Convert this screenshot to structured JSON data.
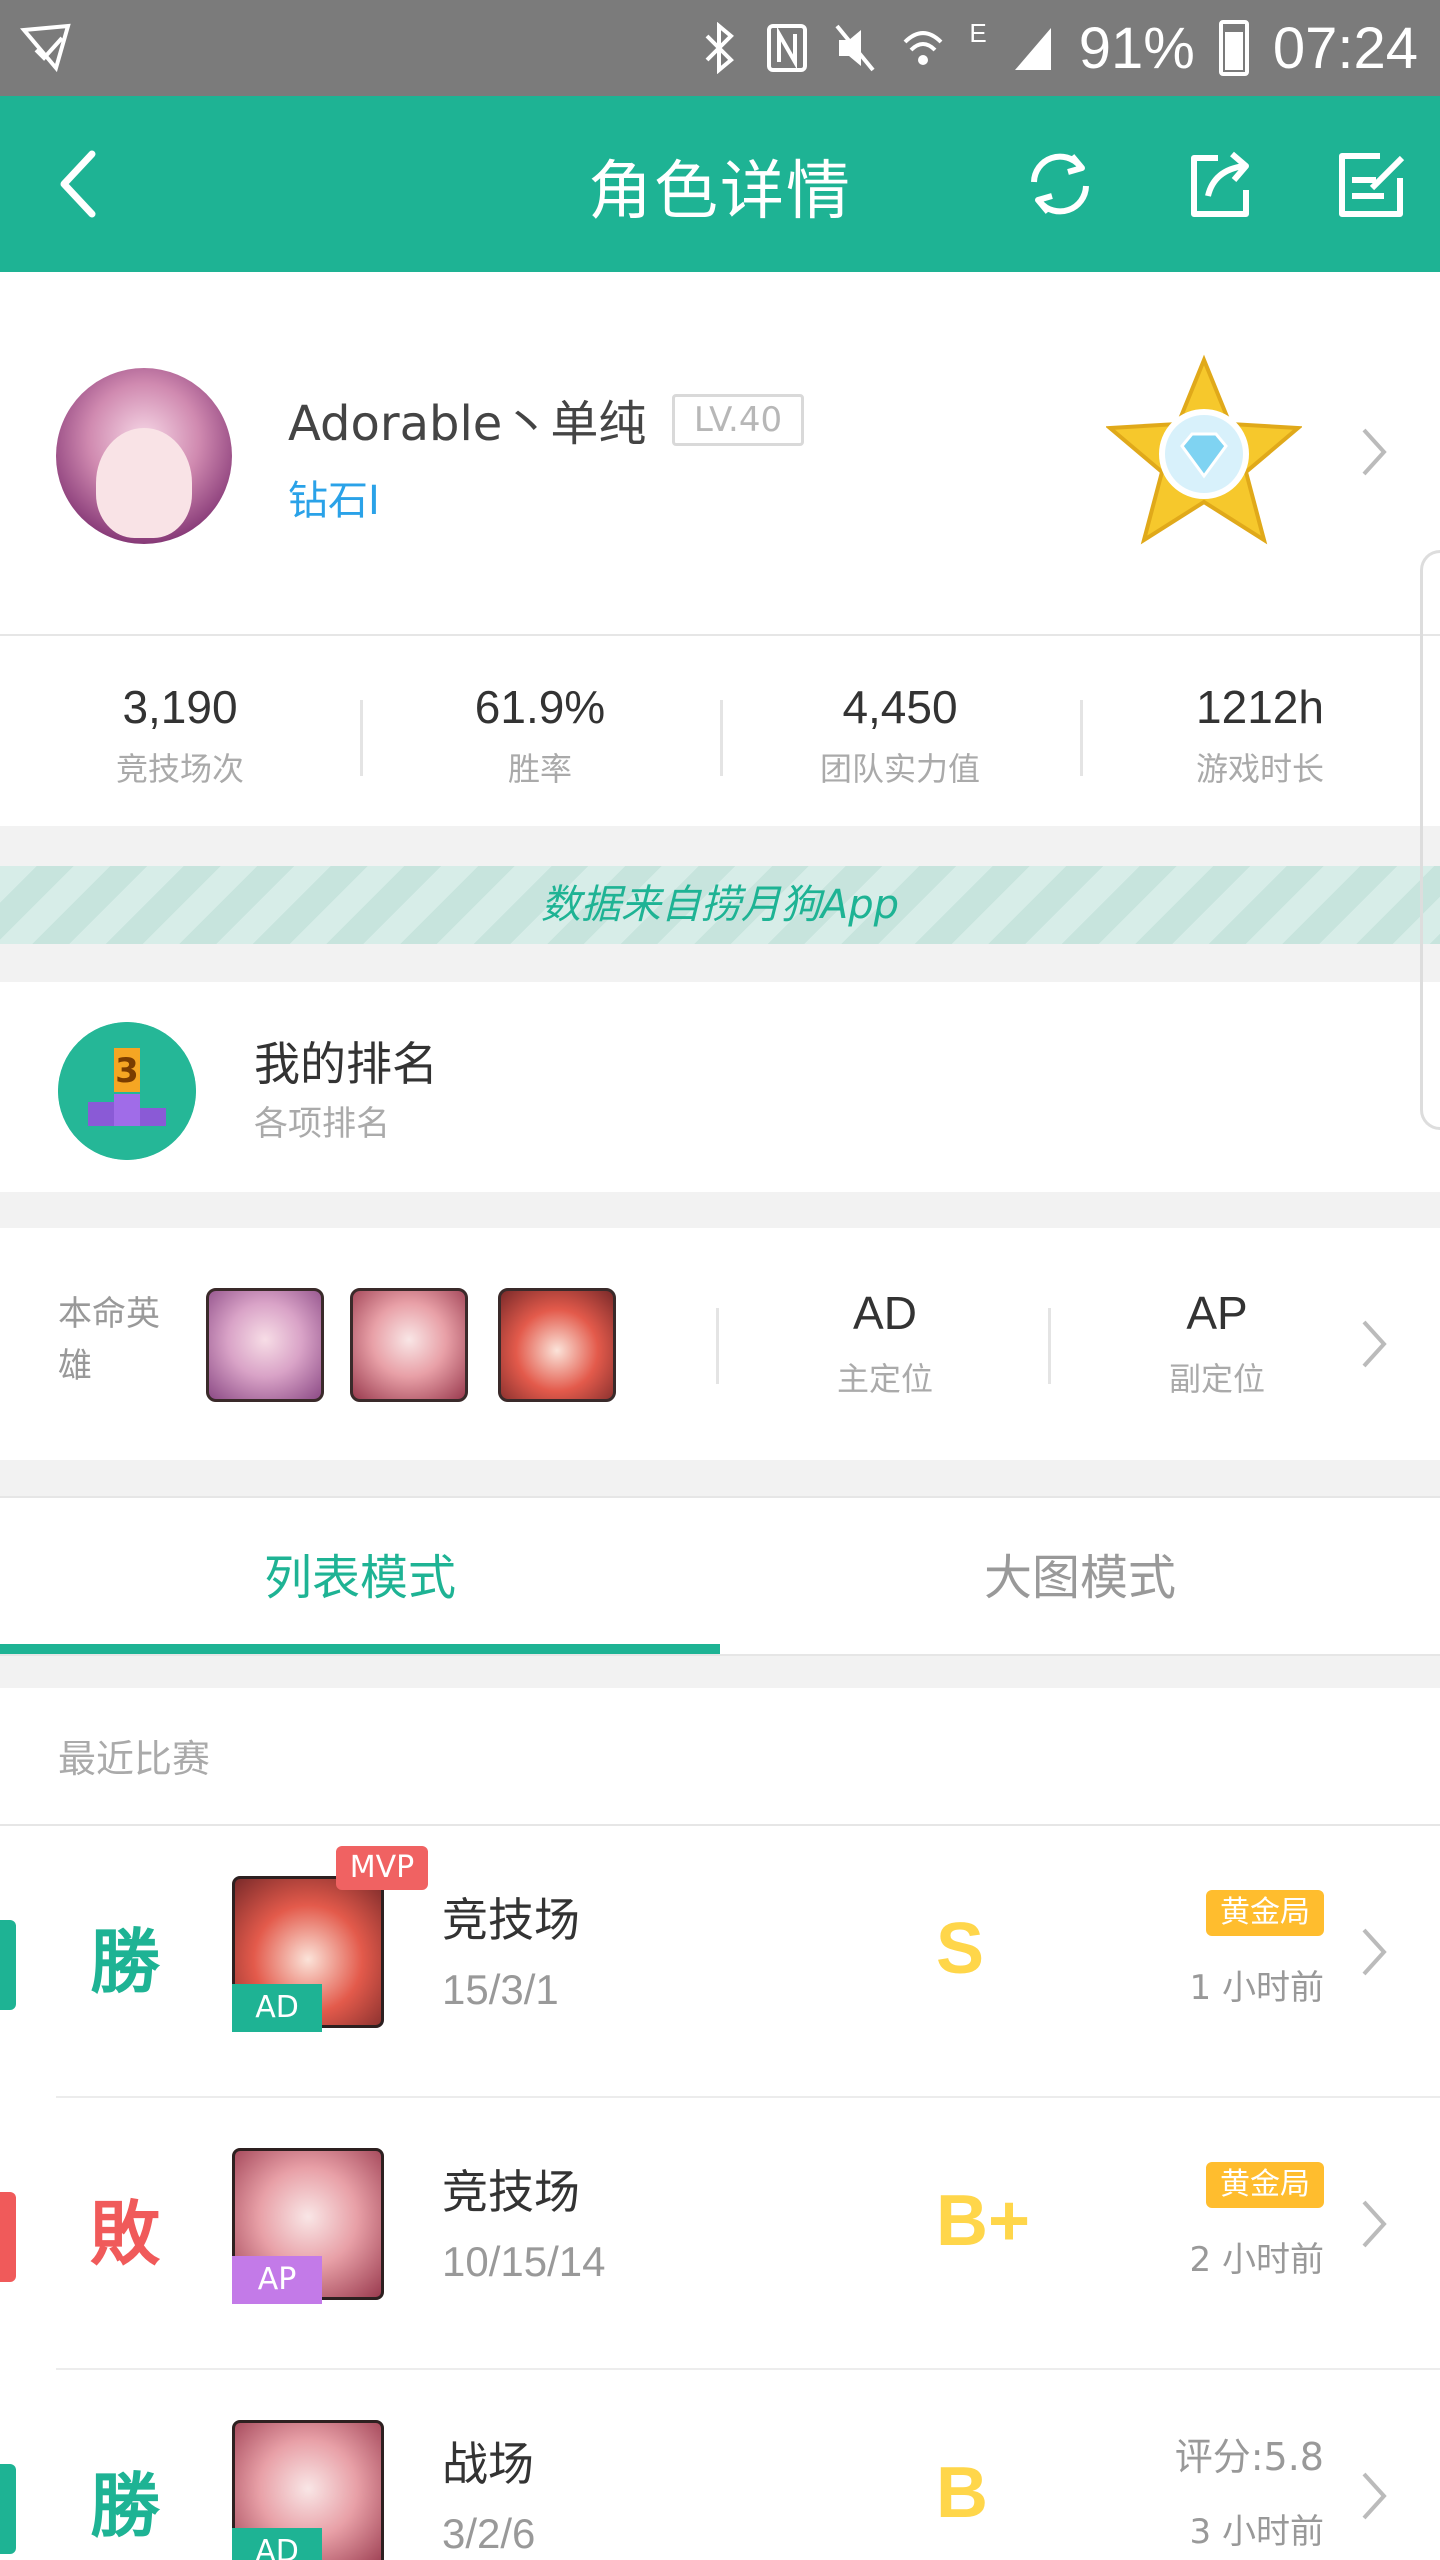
{
  "status_bar": {
    "battery": "91%",
    "time": "07:24",
    "network": "E"
  },
  "header": {
    "title": "角色详情",
    "icons": [
      "back-icon",
      "refresh-icon",
      "share-icon",
      "edit-icon"
    ]
  },
  "profile": {
    "name": "Adorable丶单纯",
    "level": "LV.40",
    "rank": "钻石I",
    "rank_icon": "diamond-star-icon"
  },
  "stats": [
    {
      "value": "3,190",
      "label": "竞技场次"
    },
    {
      "value": "61.9%",
      "label": "胜率"
    },
    {
      "value": "4,450",
      "label": "团队实力值"
    },
    {
      "value": "1212h",
      "label": "游戏时长"
    }
  ],
  "banner": {
    "text": "数据来自捞月狗App"
  },
  "my_rank": {
    "title": "我的排名",
    "subtitle": "各项排名"
  },
  "heroes": {
    "label": "本命英雄",
    "primary_value": "AD",
    "primary_label": "主定位",
    "secondary_value": "AP",
    "secondary_label": "副定位"
  },
  "tabs": [
    {
      "label": "列表模式",
      "active": true
    },
    {
      "label": "大图模式",
      "active": false
    }
  ],
  "recent": {
    "heading": "最近比赛",
    "matches": [
      {
        "result": "勝",
        "result_color": "#1eb394",
        "role": "AD",
        "role_color": "#1eb394",
        "mvp": "MVP",
        "mode": "竞技场",
        "kda": "15/3/1",
        "grade": "S",
        "badge": "黄金局",
        "time": "1 小时前"
      },
      {
        "result": "敗",
        "result_color": "#f05a5a",
        "role": "AP",
        "role_color": "#c37ae8",
        "mode": "竞技场",
        "kda": "10/15/14",
        "grade": "B+",
        "badge": "黄金局",
        "time": "2 小时前"
      },
      {
        "result": "勝",
        "result_color": "#1eb394",
        "role": "AD",
        "role_color": "#1eb394",
        "mode": "战场",
        "kda": "3/2/6",
        "grade": "B",
        "score": "评分:5.8",
        "time": "3 小时前"
      }
    ]
  },
  "colors": {
    "accent": "#1eb394",
    "win": "#1eb394",
    "loss": "#f05a5a",
    "grade": "#ffd64a",
    "gold_badge": "#ffbd2e",
    "rank_text": "#2aa2e8"
  }
}
